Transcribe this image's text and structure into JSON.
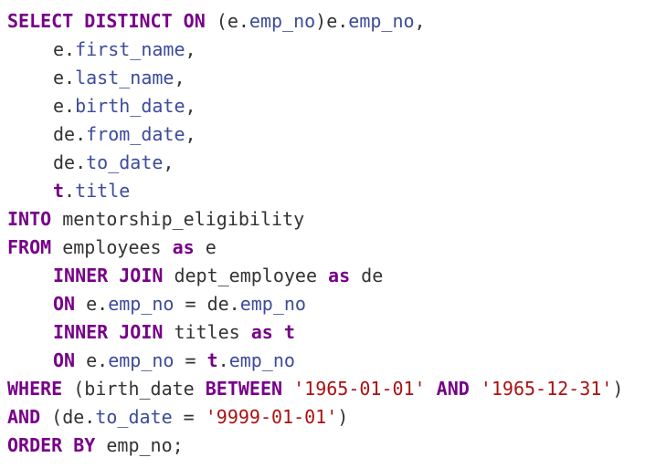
{
  "code": {
    "language": "SQL",
    "lines": [
      [
        {
          "t": "SELECT DISTINCT ON",
          "c": "kw"
        },
        {
          "t": " (e.",
          "c": "txt"
        },
        {
          "t": "emp_no",
          "c": "id"
        },
        {
          "t": ")e.",
          "c": "txt"
        },
        {
          "t": "emp_no",
          "c": "id"
        },
        {
          "t": ",",
          "c": "txt"
        }
      ],
      [
        {
          "t": "",
          "c": "ind"
        },
        {
          "t": "e.",
          "c": "txt"
        },
        {
          "t": "first_name",
          "c": "id"
        },
        {
          "t": ",",
          "c": "txt"
        }
      ],
      [
        {
          "t": "",
          "c": "ind"
        },
        {
          "t": "e.",
          "c": "txt"
        },
        {
          "t": "last_name",
          "c": "id"
        },
        {
          "t": ",",
          "c": "txt"
        }
      ],
      [
        {
          "t": "",
          "c": "ind"
        },
        {
          "t": "e.",
          "c": "txt"
        },
        {
          "t": "birth_date",
          "c": "id"
        },
        {
          "t": ",",
          "c": "txt"
        }
      ],
      [
        {
          "t": "",
          "c": "ind"
        },
        {
          "t": "de.",
          "c": "txt"
        },
        {
          "t": "from_date",
          "c": "id"
        },
        {
          "t": ",",
          "c": "txt"
        }
      ],
      [
        {
          "t": "",
          "c": "ind"
        },
        {
          "t": "de.",
          "c": "txt"
        },
        {
          "t": "to_date",
          "c": "id"
        },
        {
          "t": ",",
          "c": "txt"
        }
      ],
      [
        {
          "t": "",
          "c": "ind"
        },
        {
          "t": "t",
          "c": "var"
        },
        {
          "t": ".",
          "c": "txt"
        },
        {
          "t": "title",
          "c": "id"
        }
      ],
      [
        {
          "t": "INTO",
          "c": "kw"
        },
        {
          "t": " mentorship_eligibility",
          "c": "txt"
        }
      ],
      [
        {
          "t": "FROM",
          "c": "kw"
        },
        {
          "t": " employees ",
          "c": "txt"
        },
        {
          "t": "as",
          "c": "kw"
        },
        {
          "t": " e",
          "c": "txt"
        }
      ],
      [
        {
          "t": "",
          "c": "ind"
        },
        {
          "t": "INNER JOIN",
          "c": "kw"
        },
        {
          "t": " dept_employee ",
          "c": "txt"
        },
        {
          "t": "as",
          "c": "kw"
        },
        {
          "t": " de",
          "c": "txt"
        }
      ],
      [
        {
          "t": "",
          "c": "ind"
        },
        {
          "t": "ON",
          "c": "kw"
        },
        {
          "t": " e.",
          "c": "txt"
        },
        {
          "t": "emp_no",
          "c": "id"
        },
        {
          "t": " = de.",
          "c": "txt"
        },
        {
          "t": "emp_no",
          "c": "id"
        }
      ],
      [
        {
          "t": "",
          "c": "ind"
        },
        {
          "t": "INNER JOIN",
          "c": "kw"
        },
        {
          "t": " titles ",
          "c": "txt"
        },
        {
          "t": "as",
          "c": "kw"
        },
        {
          "t": " ",
          "c": "txt"
        },
        {
          "t": "t",
          "c": "var"
        }
      ],
      [
        {
          "t": "",
          "c": "ind"
        },
        {
          "t": "ON",
          "c": "kw"
        },
        {
          "t": " e.",
          "c": "txt"
        },
        {
          "t": "emp_no",
          "c": "id"
        },
        {
          "t": " = ",
          "c": "txt"
        },
        {
          "t": "t",
          "c": "var"
        },
        {
          "t": ".",
          "c": "txt"
        },
        {
          "t": "emp_no",
          "c": "id"
        }
      ],
      [
        {
          "t": "WHERE",
          "c": "kw"
        },
        {
          "t": " (birth_date ",
          "c": "txt"
        },
        {
          "t": "BETWEEN",
          "c": "kw"
        },
        {
          "t": " ",
          "c": "txt"
        },
        {
          "t": "'1965-01-01'",
          "c": "str"
        },
        {
          "t": " ",
          "c": "txt"
        },
        {
          "t": "AND",
          "c": "kw"
        },
        {
          "t": " ",
          "c": "txt"
        },
        {
          "t": "'1965-12-31'",
          "c": "str"
        },
        {
          "t": ")",
          "c": "txt"
        }
      ],
      [
        {
          "t": "AND",
          "c": "kw"
        },
        {
          "t": " (de.",
          "c": "txt"
        },
        {
          "t": "to_date",
          "c": "id"
        },
        {
          "t": " = ",
          "c": "txt"
        },
        {
          "t": "'9999-01-01'",
          "c": "str"
        },
        {
          "t": ")",
          "c": "txt"
        }
      ],
      [
        {
          "t": "ORDER BY",
          "c": "kw"
        },
        {
          "t": " emp_no;",
          "c": "txt"
        }
      ]
    ]
  },
  "colors": {
    "keyword": "#770088",
    "identifier": "#3d4b9a",
    "string": "#aa1111",
    "text": "#333333",
    "background": "#ffffff"
  }
}
